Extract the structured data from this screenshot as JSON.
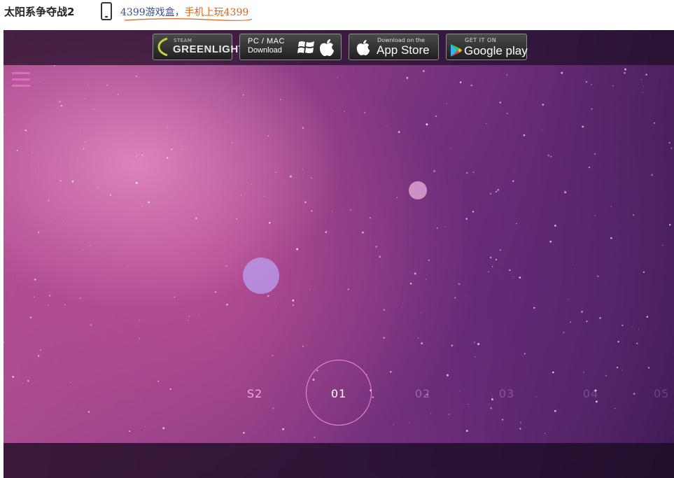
{
  "page": {
    "title": "太阳系争夺战2",
    "promo": {
      "part1": "4399游戏盒，",
      "part2": "手机上玩4399"
    }
  },
  "colors": {
    "menu_accent": "#e06dc4",
    "ring": "#f08fd0",
    "promo_blue": "#3a4b8a",
    "promo_orange": "#e0621a"
  },
  "game": {
    "downloads": {
      "greenlight": {
        "small": "STEAM",
        "label": "GREENLIGHT"
      },
      "pcmac": {
        "line1": "PC / MAC",
        "line2": "Download"
      },
      "appstore": {
        "small": "Download on the",
        "label": "App Store"
      },
      "google": {
        "small": "GET IT ON",
        "label": "Google play"
      }
    },
    "menu_icon": "hamburger-menu-icon",
    "levels": [
      "S2",
      "01",
      "02",
      "03",
      "04",
      "05"
    ],
    "selected_level": "01"
  }
}
